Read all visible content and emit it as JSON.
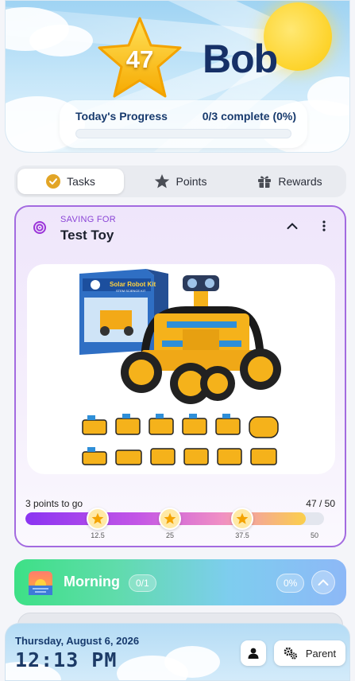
{
  "header": {
    "star_points": "47",
    "child_name": "Bob",
    "progress": {
      "title": "Today's Progress",
      "status": "0/3 complete (0%)",
      "fraction": 0
    }
  },
  "tabs": [
    {
      "label": "Tasks",
      "icon": "check-circle-icon",
      "active": true
    },
    {
      "label": "Points",
      "icon": "star-icon",
      "active": false
    },
    {
      "label": "Rewards",
      "icon": "gift-icon",
      "active": false
    }
  ],
  "saving": {
    "eyebrow": "SAVING FOR",
    "title": "Test Toy",
    "box_text": "Solar Robot Kit",
    "box_subtext": "STEM SCIENCE KIT",
    "points_to_go": "3 points to go",
    "points_fraction": "47 / 50",
    "current": 47,
    "goal": 50,
    "milestones": [
      "12.5",
      "25",
      "37.5",
      "50"
    ],
    "milestone_values": [
      12.5,
      25,
      37.5
    ]
  },
  "routine": {
    "title": "Morning",
    "count": "0/1",
    "percent": "0%",
    "icon": "sunrise-icon"
  },
  "footer": {
    "date": "Thursday, August 6, 2026",
    "time": "12:13 PM",
    "parent_label": "Parent"
  },
  "colors": {
    "accent_purple": "#a36be0",
    "navy": "#173a6d",
    "gold": "#f4b400",
    "morning_green": "#3de086",
    "morning_blue": "#8db8f7"
  }
}
